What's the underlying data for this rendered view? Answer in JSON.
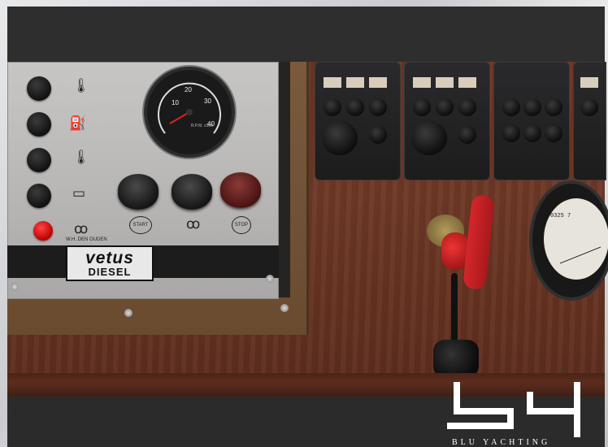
{
  "photo": {
    "subject": "boat engine control panel",
    "panel_brand": "vetus",
    "panel_subbrand": "DIESEL",
    "panel_maker": "W.H. DEN OUDEN",
    "gauge_label": "R.P.M. x100",
    "gauge_ticks": [
      "10",
      "20",
      "30",
      "40"
    ],
    "start_label": "START",
    "stop_label": "STOP",
    "tach_readout": "0325 7"
  },
  "watermark": {
    "logo_mark": "bY",
    "brand_text": "BLU YACHTING"
  },
  "colors": {
    "frame_bar": "#2e2e2f",
    "wood": "#6a3524",
    "panel_metal": "#bebdbb",
    "key_red": "#d5262a"
  }
}
